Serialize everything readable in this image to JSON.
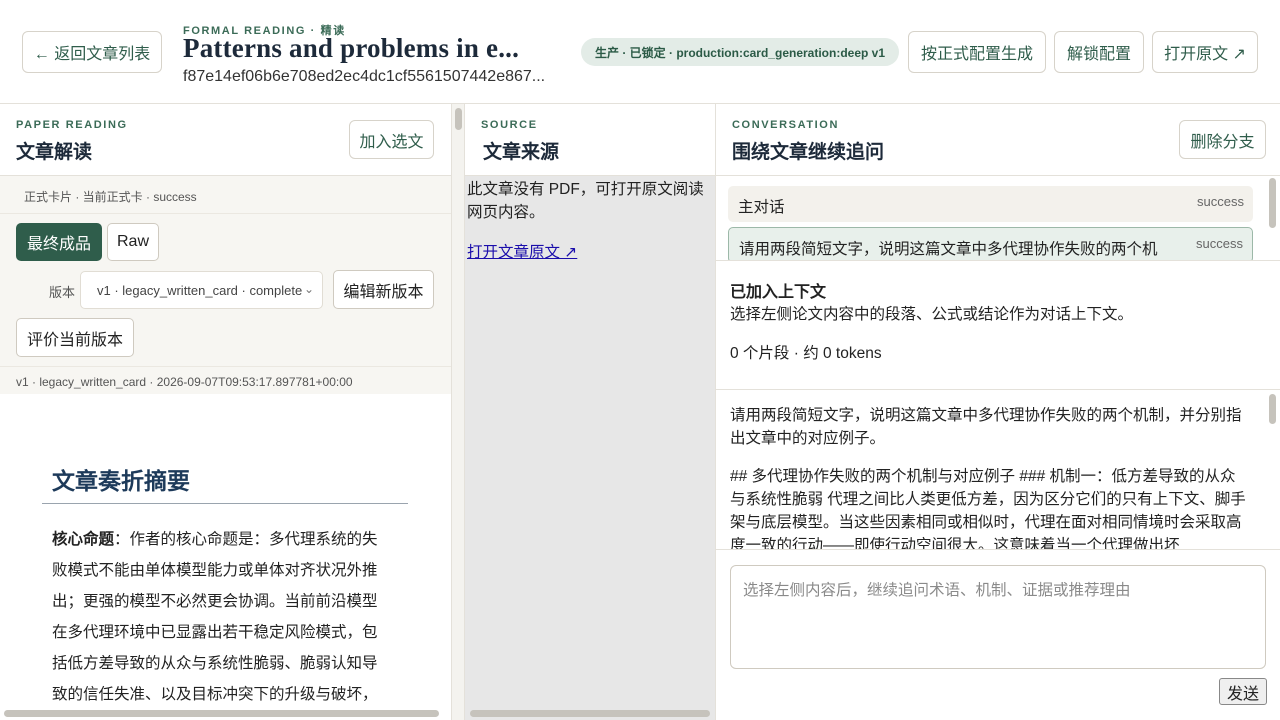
{
  "header": {
    "back_label": "← 返回文章列表",
    "eyebrow": "FORMAL READING · 精读",
    "title": "Patterns and problems in e...",
    "hash": "f87e14ef06b6e708ed2ec4dc1cf5561507442e867...",
    "badge": "生产 · 已锁定 · production:card_generation:deep v1",
    "generate_label": "按正式配置生成",
    "unlock_label": "解锁配置",
    "open_label": "打开原文 ↗"
  },
  "left": {
    "eyebrow": "PAPER READING",
    "title": "文章解读",
    "add_label": "加入选文",
    "meta": "正式卡片 · 当前正式卡 · success",
    "tab_final": "最终成品",
    "tab_raw": "Raw",
    "version_label": "版本",
    "version_value": "v1 · legacy_written_card · complete",
    "edit_label": "编辑新版本",
    "evaluate_label": "评价当前版本",
    "info": "v1 · legacy_written_card · 2026-09-07T09:53:17.897781+00:00",
    "doc_heading": "文章奏折摘要",
    "doc_lead": "核心命题",
    "doc_body": "：作者的核心命题是：多代理系统的失败模式不能由单体模型能力或单体对齐状况外推出；更强的模型不必然更会协调。当前前沿模型在多代理环境中已显露出若干稳定风险模式，包括低方差导致的从众与系统性脆弱、脆弱认知导致的信任失准、以及目标冲突下的升级与破坏，"
  },
  "mid": {
    "eyebrow": "SOURCE",
    "title": "文章来源",
    "text": "此文章没有 PDF，可打开原文阅读网页内容。",
    "link": "打开文章原文 ↗"
  },
  "right": {
    "eyebrow": "CONVERSATION",
    "title": "围绕文章继续追问",
    "delete_label": "删除分支",
    "threads": [
      {
        "label": "主对话",
        "status": "success"
      },
      {
        "label": "请用两段简短文字，说明这篇文章中多代理协作失败的两个机",
        "status": "success"
      }
    ],
    "ctx_title": "已加入上下文",
    "ctx_desc": "选择左侧论文内容中的段落、公式或结论作为对话上下文。",
    "ctx_count": "0 个片段 · 约 0 tokens",
    "msg_user": "请用两段简短文字，说明这篇文章中多代理协作失败的两个机制，并分别指出文章中的对应例子。",
    "msg_assistant": "## 多代理协作失败的两个机制与对应例子 ### 机制一：低方差导致的从众与系统性脆弱 代理之间比人类更低方差，因为区分它们的只有上下文、脚手架与底层模型。当这些因素相同或相似时，代理在面对相同情境时会采取高度一致的行动——即使行动空间很大。这意味着当一个代理做出坏",
    "composer_placeholder": "选择左侧内容后，继续追问术语、机制、证据或推荐理由",
    "send_label": "发送"
  }
}
